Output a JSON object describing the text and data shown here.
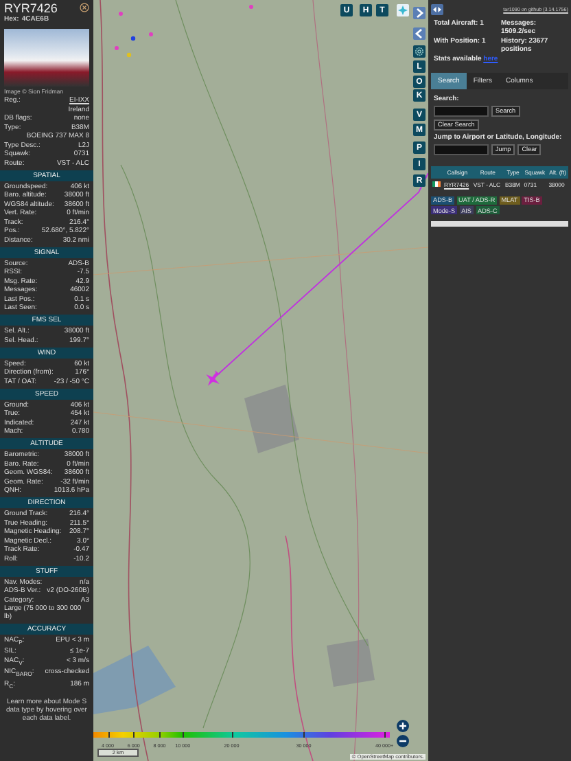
{
  "aircraft_panel": {
    "callsign": "RYR7426",
    "hex_label": "Hex:",
    "hex": "4CAE6B",
    "photo_credit": "Image © Sion Fridman",
    "details": [
      {
        "kind": "pair",
        "label": "Reg.:",
        "value": "EI-IXX",
        "link": true
      },
      {
        "kind": "value",
        "value": "Ireland"
      },
      {
        "kind": "pair",
        "label": "DB flags:",
        "value": "none",
        "link": false
      },
      {
        "kind": "pair",
        "label": "Type:",
        "value": "B38M",
        "link": false
      },
      {
        "kind": "value",
        "value": "BOEING 737 MAX 8"
      },
      {
        "kind": "pair",
        "label": "Type Desc.:",
        "value": "L2J",
        "link": false
      },
      {
        "kind": "pair",
        "label": "Squawk:",
        "value": "0731",
        "link": false
      },
      {
        "kind": "pair",
        "label": "Route:",
        "value": "VST - ALC",
        "link": false
      }
    ],
    "sections": [
      {
        "title": "SPATIAL",
        "rows": [
          {
            "kind": "pair",
            "label": "Groundspeed:",
            "value": "406 kt"
          },
          {
            "kind": "pair",
            "label": "Baro. altitude:",
            "value": "38000 ft"
          },
          {
            "kind": "pair",
            "label": "WGS84 altitude:",
            "value": "38600 ft"
          },
          {
            "kind": "pair",
            "label": "Vert. Rate:",
            "value": "0 ft/min"
          },
          {
            "kind": "pair",
            "label": "Track:",
            "value": "216.4°"
          },
          {
            "kind": "pair",
            "label": "Pos.:",
            "value": "52.680°, 5.822°"
          },
          {
            "kind": "pair",
            "label": "Distance:",
            "value": "30.2 nmi"
          }
        ]
      },
      {
        "title": "SIGNAL",
        "rows": [
          {
            "kind": "pair",
            "label": "Source:",
            "value": "ADS-B"
          },
          {
            "kind": "pair",
            "label": "RSSI:",
            "value": "-7.5"
          },
          {
            "kind": "pair",
            "label": "Msg. Rate:",
            "value": "42.9"
          },
          {
            "kind": "pair",
            "label": "Messages:",
            "value": "46002"
          },
          {
            "kind": "pair",
            "label": "Last Pos.:",
            "value": "0.1 s"
          },
          {
            "kind": "pair",
            "label": "Last Seen:",
            "value": "0.0 s"
          }
        ]
      },
      {
        "title": "FMS SEL",
        "rows": [
          {
            "kind": "pair",
            "label": "Sel. Alt.:",
            "value": "38000 ft"
          },
          {
            "kind": "pair",
            "label": "Sel. Head.:",
            "value": "199.7°"
          }
        ]
      },
      {
        "title": "WIND",
        "rows": [
          {
            "kind": "pair",
            "label": "Speed:",
            "value": "60 kt"
          },
          {
            "kind": "pair",
            "label": "Direction (from):",
            "value": "176°"
          },
          {
            "kind": "pair",
            "label": "TAT / OAT:",
            "value": "-23 / -50 °C"
          }
        ]
      },
      {
        "title": "SPEED",
        "rows": [
          {
            "kind": "pair",
            "label": "Ground:",
            "value": "406 kt"
          },
          {
            "kind": "pair",
            "label": "True:",
            "value": "454 kt"
          },
          {
            "kind": "pair",
            "label": "Indicated:",
            "value": "247 kt"
          },
          {
            "kind": "pair",
            "label": "Mach:",
            "value": "0.780"
          }
        ]
      },
      {
        "title": "ALTITUDE",
        "rows": [
          {
            "kind": "pair",
            "label": "Barometric:",
            "value": "38000 ft"
          },
          {
            "kind": "pair",
            "label": "Baro. Rate:",
            "value": "0 ft/min"
          },
          {
            "kind": "pair",
            "label": "Geom. WGS84:",
            "value": "38600 ft"
          },
          {
            "kind": "pair",
            "label": "Geom. Rate:",
            "value": "-32 ft/min"
          },
          {
            "kind": "pair",
            "label": "QNH:",
            "value": "1013.6 hPa"
          }
        ]
      },
      {
        "title": "DIRECTION",
        "rows": [
          {
            "kind": "pair",
            "label": "Ground Track:",
            "value": "216.4°"
          },
          {
            "kind": "pair",
            "label": "True Heading:",
            "value": "211.5°"
          },
          {
            "kind": "pair",
            "label": "Magnetic Heading:",
            "value": "208.7°"
          },
          {
            "kind": "pair",
            "label": "Magnetic Decl.:",
            "value": "3.0°"
          },
          {
            "kind": "pair",
            "label": "Track Rate:",
            "value": "-0.47"
          },
          {
            "kind": "pair",
            "label": "Roll:",
            "value": "-10.2"
          }
        ]
      },
      {
        "title": "STUFF",
        "rows": [
          {
            "kind": "pair",
            "label": "Nav. Modes:",
            "value": "n/a"
          },
          {
            "kind": "pair",
            "label": "ADS-B Ver.:",
            "value": "v2 (DO-260B)"
          },
          {
            "kind": "pair",
            "label": "Category:",
            "value": "A3"
          },
          {
            "kind": "note",
            "value": "Large (75 000 to 300 000 lb)"
          }
        ]
      },
      {
        "title": "ACCURACY",
        "rows": [
          {
            "kind": "pair",
            "label": "NAC$_{P}$:",
            "value": "EPU < 3 m"
          },
          {
            "kind": "pair",
            "label": "SIL:",
            "value": "≤ 1e-7"
          },
          {
            "kind": "pair",
            "label": "NAC$_{V}$:",
            "value": "< 3 m/s"
          },
          {
            "kind": "pair",
            "label": "NIC$_{BARO}$:",
            "value": "cross-checked"
          },
          {
            "kind": "pair",
            "label": "R$_{C}$:",
            "value": "186 m"
          }
        ]
      }
    ],
    "footer": "Learn more about Mode S data type by hovering over each data label."
  },
  "map": {
    "top_buttons": [
      {
        "kind": "letter",
        "label": "U"
      },
      {
        "kind": "letter",
        "label": "H"
      },
      {
        "kind": "letter",
        "label": "T"
      },
      {
        "kind": "layers"
      }
    ],
    "side_buttons": [
      {
        "kind": "expand"
      },
      {
        "kind": "collapse"
      },
      {
        "kind": "gear"
      },
      {
        "kind": "letter",
        "label": "L"
      },
      {
        "kind": "letter",
        "label": "O"
      },
      {
        "kind": "letter",
        "label": "K"
      },
      {
        "kind": "letter",
        "label": "V"
      },
      {
        "kind": "letter",
        "label": "M"
      },
      {
        "kind": "letter",
        "label": "P"
      },
      {
        "kind": "letter",
        "label": "I"
      },
      {
        "kind": "letter",
        "label": "R"
      }
    ],
    "legend_labels": [
      "4 000",
      "6 000",
      "8 000",
      "10 000",
      "20 000",
      "30 000",
      "40 000+"
    ],
    "scale": "2 km",
    "attribution": "© OpenStreetMap contributors."
  },
  "side_panel": {
    "version_link": "tar1090 on github (3.14.1756)",
    "stats": [
      {
        "label": "Total Aircraft:",
        "value": "1"
      },
      {
        "label": "Messages:",
        "value": "1509.2/sec"
      },
      {
        "label": "With Position:",
        "value": "1"
      },
      {
        "label": "History:",
        "value": "23677 positions"
      }
    ],
    "stats_text": "Stats available",
    "stats_link": "here",
    "tabs": [
      {
        "label": "Search",
        "selected": true
      },
      {
        "label": "Filters",
        "selected": false
      },
      {
        "label": "Columns",
        "selected": false
      }
    ],
    "search_label": "Search:",
    "search_button": "Search",
    "clear_search_button": "Clear Search",
    "jump_label": "Jump to Airport or Latitude, Longitude:",
    "jump_button": "Jump",
    "clear_button": "Clear",
    "table": {
      "columns": [
        "Callsign",
        "Route",
        "Type",
        "Squawk",
        "Alt. (ft)"
      ],
      "rows": [
        {
          "callsign": "RYR7426",
          "route": "VST - ALC",
          "type": "B38M",
          "squawk": "0731",
          "altitude": "38000"
        }
      ]
    },
    "sources": [
      {
        "label": "ADS-B",
        "color": "#1b4f72"
      },
      {
        "label": "UAT / ADS-R",
        "color": "#1e6b3c"
      },
      {
        "label": "MLAT",
        "color": "#6e5d1e"
      },
      {
        "label": "TIS-B",
        "color": "#6b1f3f"
      },
      {
        "label": "Mode-S",
        "color": "#3b2e78"
      },
      {
        "label": "AIS",
        "color": "#3d3d5c"
      },
      {
        "label": "ADS-C",
        "color": "#1e5e3a"
      }
    ]
  }
}
